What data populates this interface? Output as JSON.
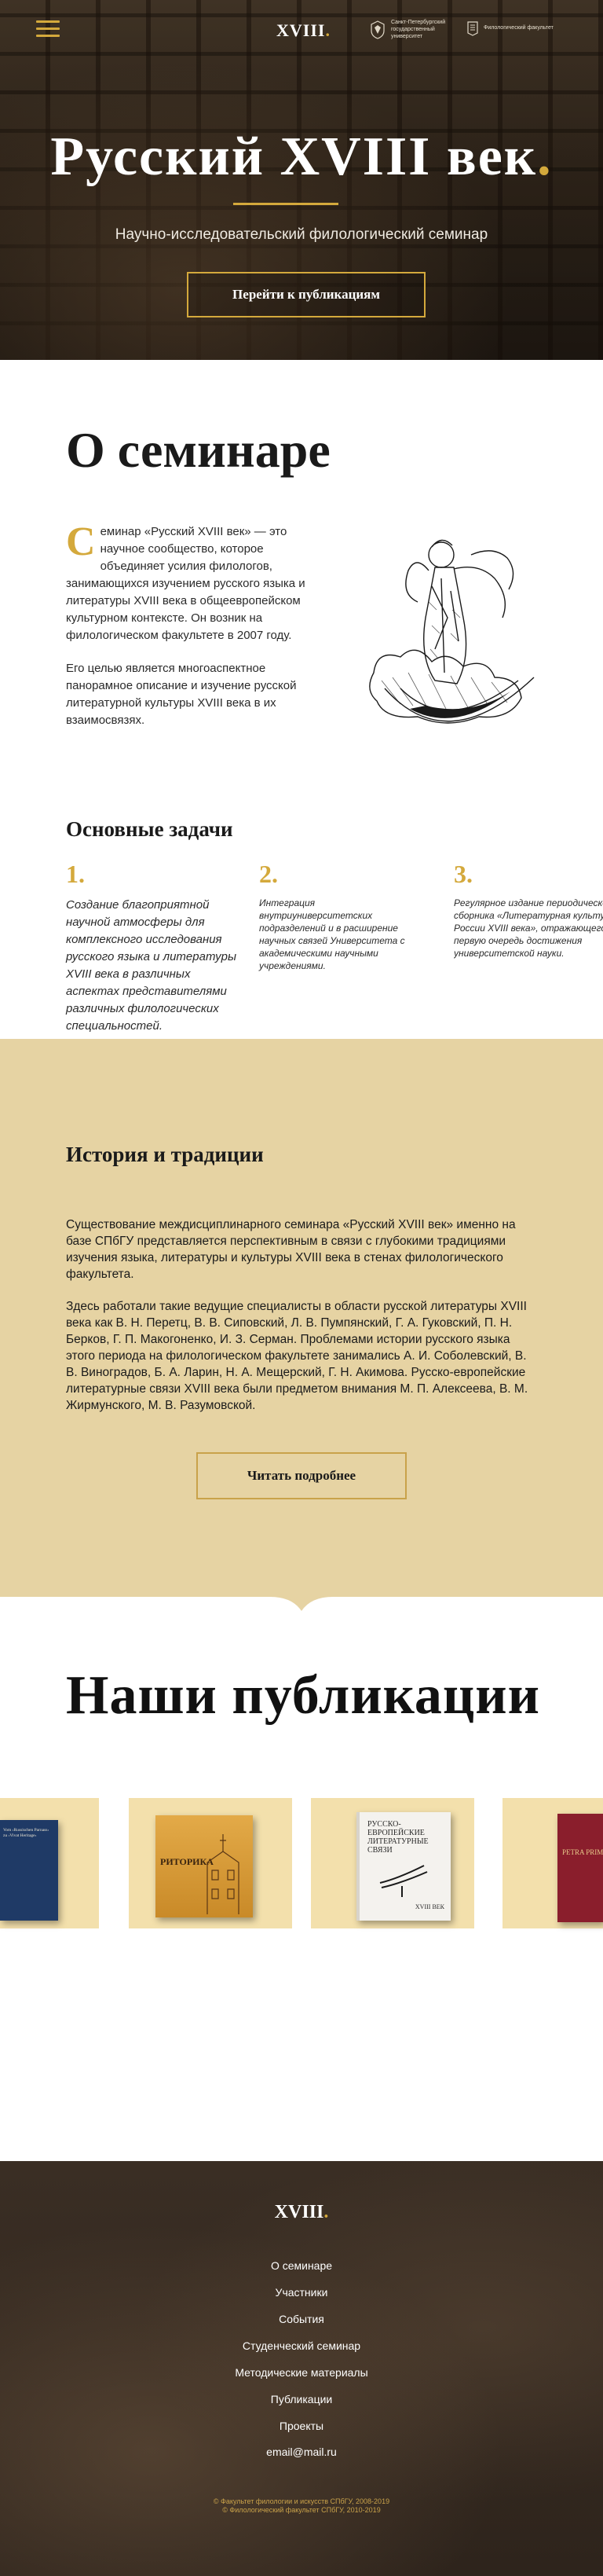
{
  "header": {
    "logo": "XVIII",
    "logo_dot": ".",
    "partners": [
      {
        "name": "Санкт-Петербургский государственный университет"
      },
      {
        "name": "Филологический факультет"
      }
    ]
  },
  "hero": {
    "title": "Русский XVIII век",
    "title_dot": ".",
    "subtitle": "Научно-исследовательский филологический семинар",
    "cta": "Перейти к публикациям"
  },
  "about": {
    "title": "О семинаре",
    "dropcap": "С",
    "p1": "еминар «Русский XVIII век» — это научное сообщество, которое объединяет усилия филологов, занимающихся изучением русского языка и литературы XVIII века в общеевропейском культурном контексте. Он возник на филологическом факультете в 2007 году.",
    "p2": "Его целью является многоаспектное панорамное описание и изучение русской литературной культуры XVIII века в их взаимосвязях."
  },
  "tasks": {
    "title": "Основные задачи",
    "items": [
      {
        "num": "1.",
        "text": "Создание благоприятной научной атмосферы для комплексного исследования русского языка и литературы XVIII века в различных аспектах представителями различных филологических специальностей."
      },
      {
        "num": "2.",
        "text": "Интеграция внутриуниверситетских подразделений и в расширение научных связей Университета с академическими научными учреждениями."
      },
      {
        "num": "3.",
        "text": "Регулярное издание периодического сборника «Литературная культура России XVIII века», отражающего в первую очередь достижения университетской науки."
      }
    ]
  },
  "history": {
    "title": "История и традиции",
    "p1": "Существование междисциплинарного семинара «Русский XVIII век» именно на базе СПбГУ представляется перспективным в связи с глубокими традициями изучения языка, литературы и культуры XVIII века в стенах филологического факультета.",
    "p2": "Здесь работали такие ведущие специалисты в области русской литературы XVIII века как В. Н. Перетц, В. В. Сиповский, Л. В. Пумпянский, Г. А. Гуковский, П. Н. Берков, Г. П. Макогоненко, И. З. Серман. Проблемами истории русского языка этого периода на филологическом факультете занимались А. И. Соболевский, В. В. Виноградов, Б. А. Ларин, Н. А. Мещерский, Г. Н. Акимова. Русско-европейские литературные связи XVIII века были предметом внимания М. П. Алексеева, В. М. Жирмунского, М. В. Разумовской.",
    "cta": "Читать подробнее"
  },
  "publications": {
    "title": "Наши публикации",
    "books": [
      {
        "title": "Vom ‹Russischen Parnass› zu ‹Vivat Heritage›",
        "cover": "#1f3a66"
      },
      {
        "title": "РИТОРИКА",
        "cover": "#d79a36"
      },
      {
        "title": "РУССКО-ЕВРОПЕЙСКИЕ ЛИТЕРАТУРНЫЕ СВЯЗИ",
        "subtitle": "XVIII ВЕК",
        "cover": "#f4f2ee"
      },
      {
        "title": "PETRA PRIMA",
        "cover": "#8a1e2c"
      }
    ]
  },
  "footer": {
    "logo": "XVIII",
    "logo_dot": ".",
    "nav": [
      "О семинаре",
      "Участники",
      "События",
      "Студенческий семинар",
      "Методические материалы",
      "Публикации",
      "Проекты"
    ],
    "email": "email@mail.ru",
    "copyright_1": "© Факультет филологии и искусств СПбГУ, 2008-2019",
    "copyright_2": "© Филологический факультет СПбГУ, 2010-2019"
  },
  "colors": {
    "accent": "#d4a93c",
    "history_bg": "#e6d3a3",
    "card_bg": "#f3e0ac"
  }
}
